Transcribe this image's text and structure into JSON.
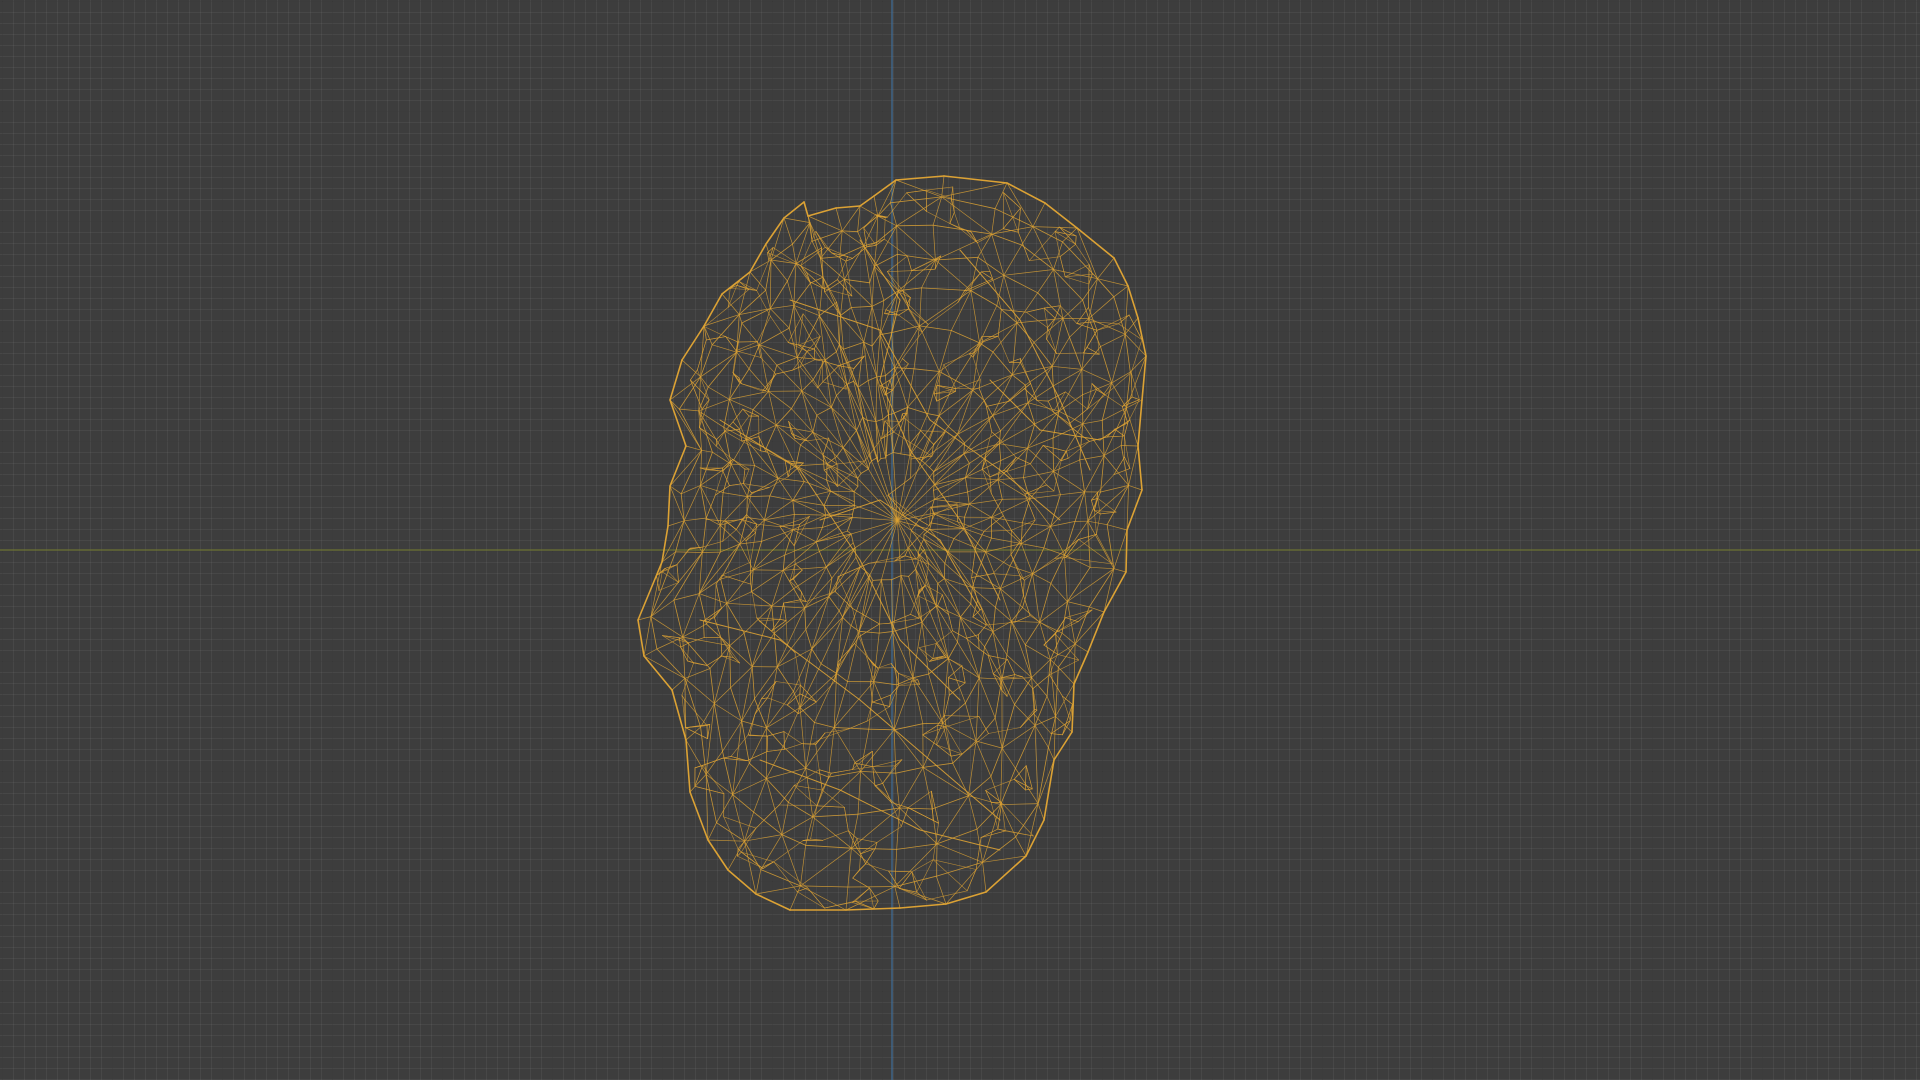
{
  "viewport": {
    "mode": "wireframe",
    "background_color": "#3d3d3d",
    "grid_visible": true,
    "grid_major_color": "#333333",
    "grid_minor_color": "#454545"
  },
  "axes": {
    "x_axis_color": "#6b7232",
    "z_axis_color": "#3f6f9a"
  },
  "object": {
    "type": "rock-mesh",
    "display": "wireframe",
    "wire_color": "#dca234",
    "selected": true
  }
}
